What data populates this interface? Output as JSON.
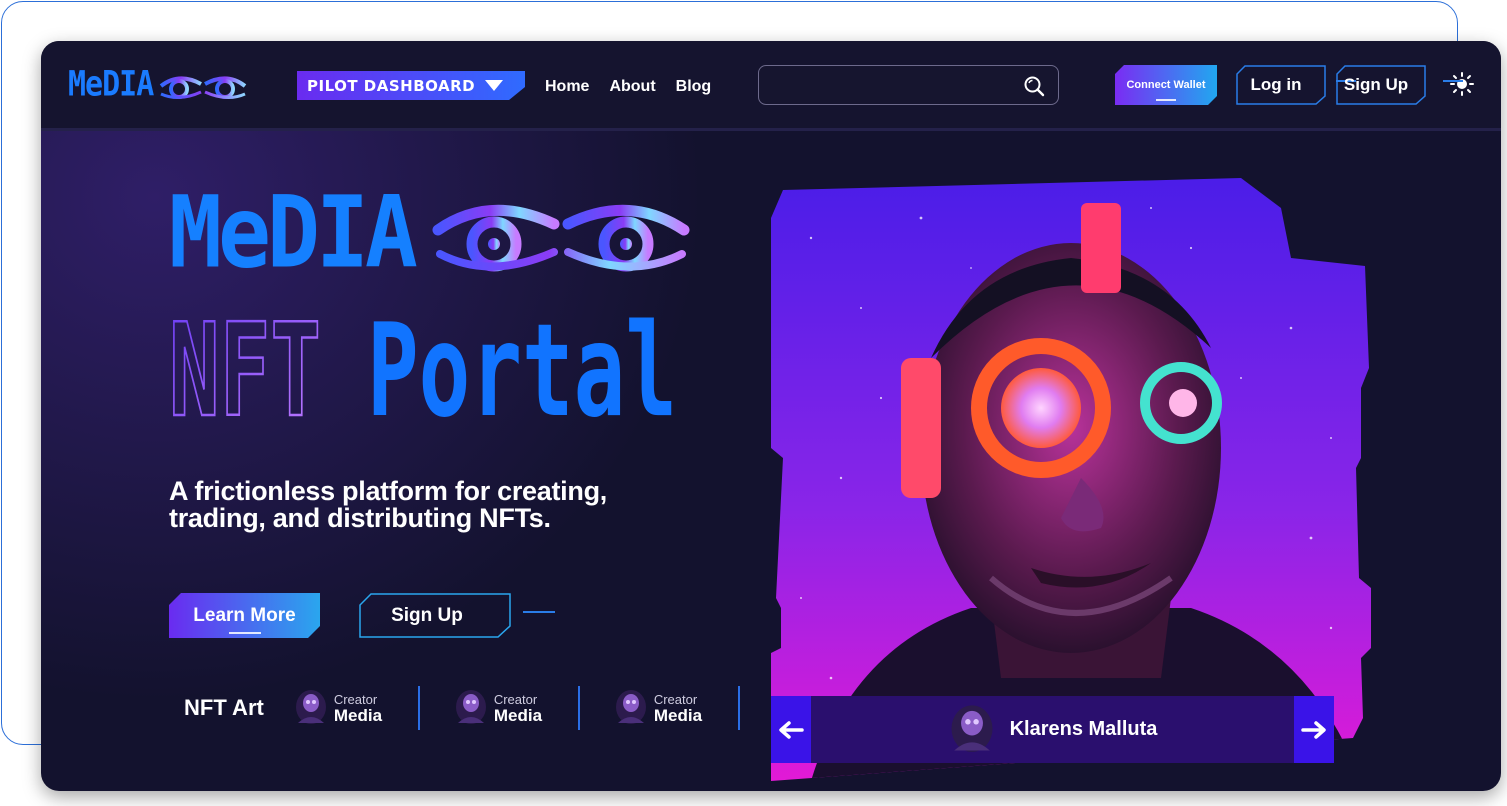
{
  "brand": {
    "logo_text": "MeDIA",
    "hero_title": "MeDIA",
    "hero_word1": "NFT",
    "hero_word2": "Portal"
  },
  "header": {
    "pilot_label": "PILOT DASHBOARD",
    "nav": [
      {
        "label": "Home"
      },
      {
        "label": "About"
      },
      {
        "label": "Blog"
      }
    ],
    "search": {
      "value": "",
      "placeholder": ""
    },
    "connect_wallet": "Connect Wallet",
    "login": "Log in",
    "signup": "Sign Up"
  },
  "hero": {
    "tagline_line1": "A frictionless platform for creating,",
    "tagline_line2": "trading, and distributing NFTs.",
    "learn_more": "Learn More",
    "sign_up": "Sign Up"
  },
  "creators": {
    "section_label": "NFT Art",
    "items": [
      {
        "role": "Creator",
        "name": "Media"
      },
      {
        "role": "Creator",
        "name": "Media"
      },
      {
        "role": "Creator",
        "name": "Media"
      }
    ]
  },
  "artwork": {
    "owner_name": "Klarens Malluta"
  },
  "colors": {
    "background": "#13122e",
    "accent_blue": "#1580ff",
    "accent_purple": "#6a2bf0",
    "accent_cyan": "#21a7f0"
  },
  "icons": [
    "eye-logo-icon",
    "chevron-down-icon",
    "search-icon",
    "sun-icon",
    "arrow-left-icon",
    "arrow-right-icon",
    "creator-avatar-icon"
  ]
}
